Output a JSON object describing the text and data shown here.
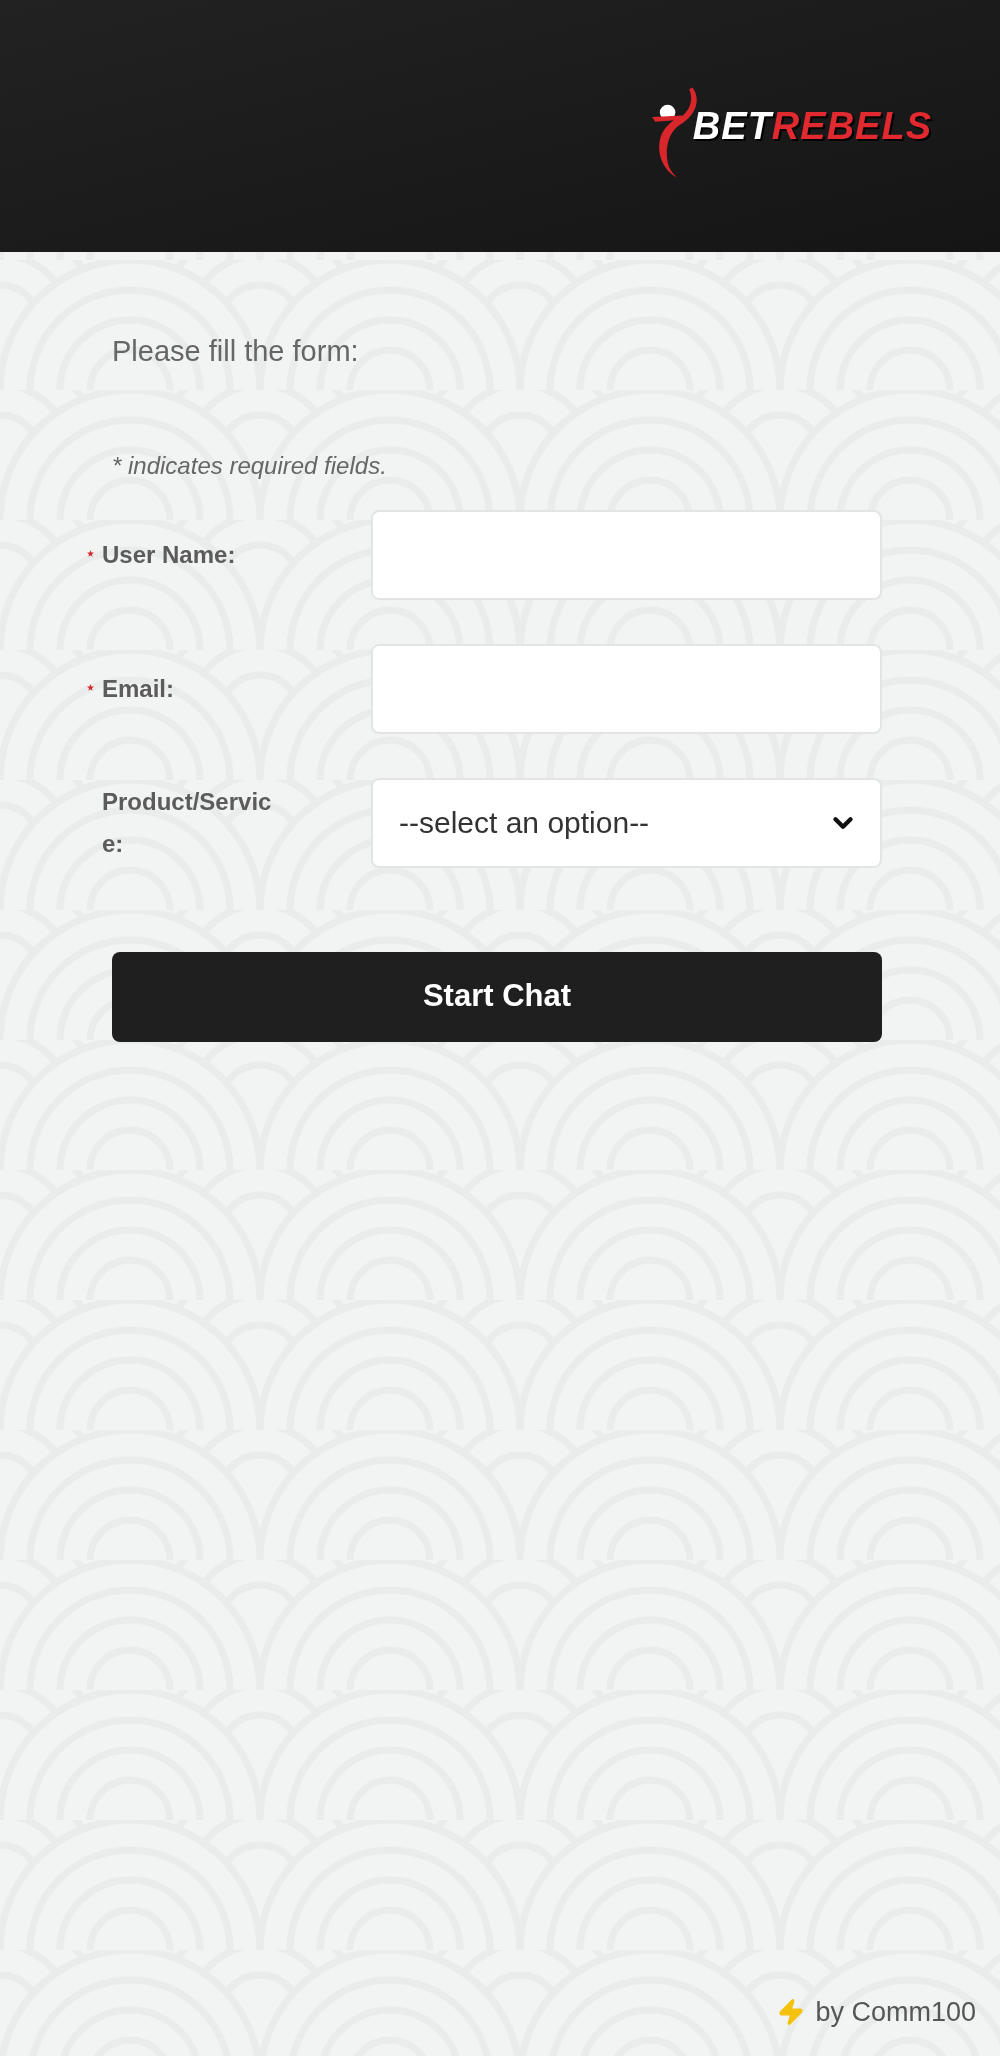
{
  "header": {
    "logo": {
      "first_word": "BET",
      "second_word": "REBELS"
    }
  },
  "form": {
    "heading": "Please fill the form:",
    "required_note": "* indicates required fields.",
    "fields": [
      {
        "kind": "text",
        "label": "User Name:",
        "required": true
      },
      {
        "kind": "text",
        "label": "Email:",
        "required": true
      },
      {
        "kind": "select",
        "label": "Product/Service:",
        "required": false,
        "value": "--select an option--"
      }
    ],
    "submit_button": "Start Chat"
  },
  "footer": {
    "credit": "by Comm100"
  }
}
